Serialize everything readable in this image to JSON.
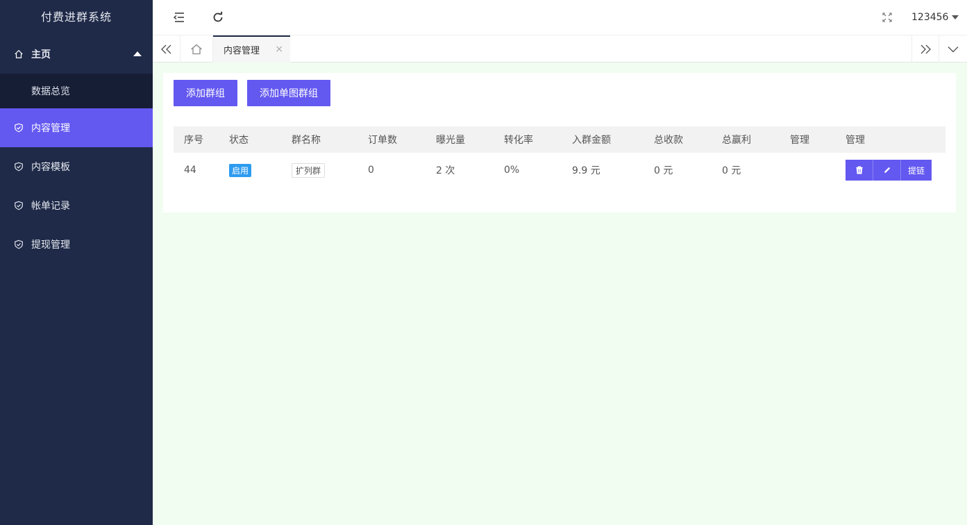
{
  "app": {
    "title": "付费进群系统"
  },
  "sidebar": {
    "items": [
      {
        "label": "主页"
      },
      {
        "label": "数据总览"
      },
      {
        "label": "内容管理"
      },
      {
        "label": "内容模板"
      },
      {
        "label": "帐单记录"
      },
      {
        "label": "提现管理"
      }
    ]
  },
  "header": {
    "username": "123456"
  },
  "tabs": {
    "active": "内容管理",
    "close_glyph": "×"
  },
  "toolbar": {
    "add_group": "添加群组",
    "add_single": "添加单图群组"
  },
  "table": {
    "columns": [
      "序号",
      "状态",
      "群名称",
      "订单数",
      "曝光量",
      "转化率",
      "入群金额",
      "总收款",
      "总赢利",
      "管理",
      "管理"
    ],
    "rows": [
      {
        "id": "44",
        "status": "启用",
        "name": "扩列群",
        "orders": "0",
        "views": "2 次",
        "conversion": "0%",
        "price": "9.9 元",
        "revenue": "0 元",
        "profit": "0 元",
        "actions": {
          "extract": "提链"
        }
      }
    ]
  },
  "colors": {
    "sidebar": "#1f2a48",
    "accent": "#6358f0",
    "badge": "#2d9bf0",
    "page_bg": "#f0fdf0"
  }
}
